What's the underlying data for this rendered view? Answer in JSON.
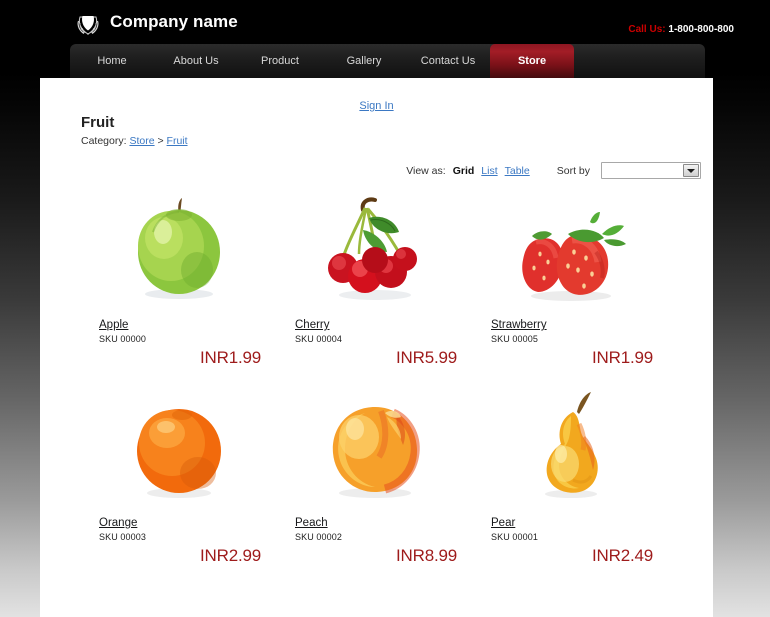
{
  "header": {
    "logo_icon": "shield-laurel-logo-icon",
    "brand_name": "Company name",
    "call_us_label": "Call Us:",
    "phone": "1-800-800-800"
  },
  "nav": {
    "items": [
      {
        "label": "Home",
        "active": false
      },
      {
        "label": "About Us",
        "active": false
      },
      {
        "label": "Product",
        "active": false
      },
      {
        "label": "Gallery",
        "active": false
      },
      {
        "label": "Contact Us",
        "active": false
      },
      {
        "label": "Store",
        "active": true
      }
    ]
  },
  "account": {
    "sign_in_label": "Sign In"
  },
  "page": {
    "title": "Fruit",
    "category_label": "Category:",
    "breadcrumb": [
      {
        "label": "Store",
        "link": true
      },
      {
        "label": ">",
        "link": false
      },
      {
        "label": "Fruit",
        "link": true
      }
    ]
  },
  "toolbar": {
    "view_as_label": "View as:",
    "view_options": [
      {
        "label": "Grid",
        "active": true
      },
      {
        "label": "List",
        "active": false
      },
      {
        "label": "Table",
        "active": false
      }
    ],
    "sort_by_label": "Sort by",
    "sort_selected_value": "",
    "sort_caret_icon": "chevron-down-icon"
  },
  "products": [
    {
      "name": "Apple",
      "sku": "SKU 00000",
      "price": "INR1.99",
      "image": "green-apple-image"
    },
    {
      "name": "Cherry",
      "sku": "SKU 00004",
      "price": "INR5.99",
      "image": "cherries-image"
    },
    {
      "name": "Strawberry",
      "sku": "SKU 00005",
      "price": "INR1.99",
      "image": "strawberries-image"
    },
    {
      "name": "Orange",
      "sku": "SKU 00003",
      "price": "INR2.99",
      "image": "orange-image"
    },
    {
      "name": "Peach",
      "sku": "SKU 00002",
      "price": "INR8.99",
      "image": "peach-image"
    },
    {
      "name": "Pear",
      "sku": "SKU 00001",
      "price": "INR2.49",
      "image": "pear-image"
    }
  ],
  "colors": {
    "accent_red": "#cc0000",
    "price_red": "#9e1b1b",
    "link_blue": "#3b78c3",
    "active_tab_red": "#a31d26"
  }
}
